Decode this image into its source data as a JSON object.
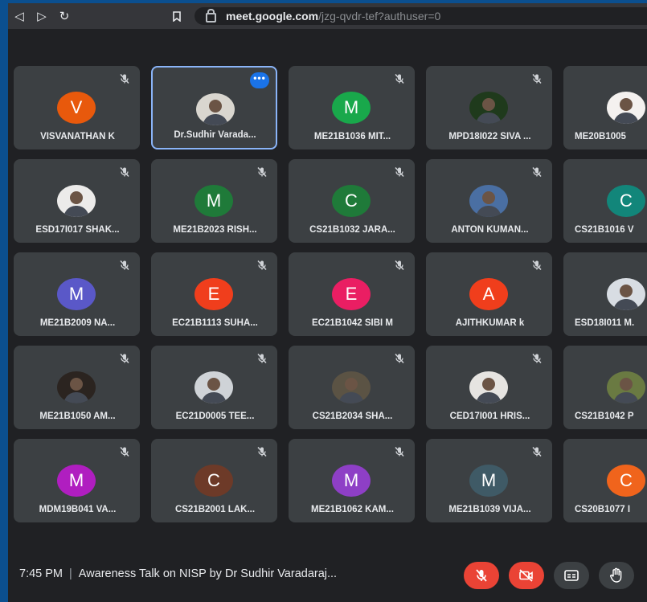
{
  "browser": {
    "url_host": "meet.google.com",
    "url_path": "/jzg-qvdr-tef?authuser=0"
  },
  "participants": [
    {
      "name": "VISVANATHAN K",
      "initial": "V",
      "color": "#e8590c",
      "type": "initial"
    },
    {
      "name": "Dr.Sudhir Varada...",
      "type": "photo",
      "photo_bg": "#d9d6cf"
    },
    {
      "name": "ME21B1036 MIT...",
      "initial": "M",
      "color": "#19a84b",
      "type": "initial"
    },
    {
      "name": "MPD18I022 SIVA ...",
      "type": "photo",
      "photo_bg": "#1f3a1c"
    },
    {
      "name": "ME20B1005",
      "type": "photo",
      "photo_bg": "#f4f1ef"
    },
    {
      "name": "ESD17I017 SHAK...",
      "type": "photo",
      "photo_bg": "#ecebea"
    },
    {
      "name": "ME21B2023 RISH...",
      "initial": "M",
      "color": "#1f7a39",
      "type": "initial"
    },
    {
      "name": "CS21B1032 JARA...",
      "initial": "C",
      "color": "#1f7a39",
      "type": "initial"
    },
    {
      "name": "ANTON KUMAN...",
      "type": "photo",
      "photo_bg": "#4a6fa3"
    },
    {
      "name": "CS21B1016 V",
      "initial": "C",
      "color": "#12867a",
      "type": "initial"
    },
    {
      "name": "ME21B2009 NA...",
      "initial": "M",
      "color": "#5a58c8",
      "type": "initial"
    },
    {
      "name": "EC21B1113 SUHA...",
      "initial": "E",
      "color": "#f03e1c",
      "type": "initial"
    },
    {
      "name": "EC21B1042 SIBI M",
      "initial": "E",
      "color": "#ea1e63",
      "type": "initial"
    },
    {
      "name": "AJITHKUMAR k",
      "initial": "A",
      "color": "#f03e1c",
      "type": "initial"
    },
    {
      "name": "ESD18I011 M.",
      "type": "photo",
      "photo_bg": "#d8dde3"
    },
    {
      "name": "ME21B1050 AM...",
      "type": "photo",
      "photo_bg": "#2b2420"
    },
    {
      "name": "EC21D0005 TEE...",
      "type": "photo",
      "photo_bg": "#cfd3d7"
    },
    {
      "name": "CS21B2034 SHA...",
      "type": "photo",
      "photo_bg": "#5b5344"
    },
    {
      "name": "CED17I001 HRIS...",
      "type": "photo",
      "photo_bg": "#e6e4e1"
    },
    {
      "name": "CS21B1042 P",
      "type": "photo",
      "photo_bg": "#6a7a42"
    },
    {
      "name": "MDM19B041 VA...",
      "initial": "M",
      "color": "#b01ec0",
      "type": "initial"
    },
    {
      "name": "CS21B2001 LAK...",
      "initial": "C",
      "color": "#6d3a28",
      "type": "initial"
    },
    {
      "name": "ME21B1062 KAM...",
      "initial": "M",
      "color": "#8e3fc6",
      "type": "initial"
    },
    {
      "name": "ME21B1039 VIJA...",
      "initial": "M",
      "color": "#3f5a66",
      "type": "initial"
    },
    {
      "name": "CS20B1077 I",
      "initial": "C",
      "color": "#f0641c",
      "type": "initial"
    }
  ],
  "bottom": {
    "time": "7:45 PM",
    "separator": "|",
    "meeting_title": "Awareness Talk on NISP by Dr Sudhir Varadaraj..."
  }
}
